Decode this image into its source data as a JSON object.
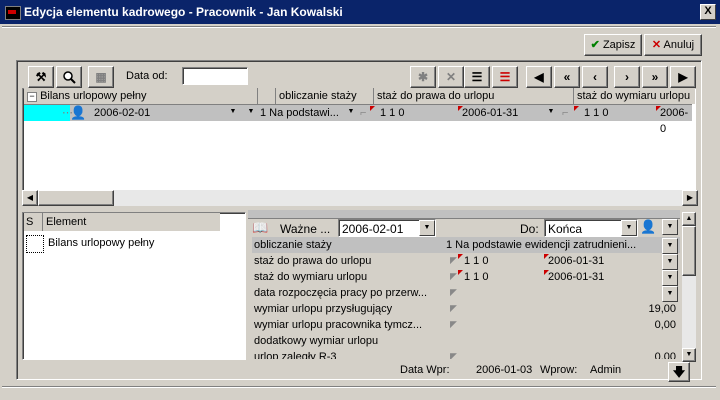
{
  "window": {
    "title": "Edycja elementu kadrowego - Pracownik - Jan Kowalski",
    "close_glyph": "X"
  },
  "actions": {
    "save": "Zapisz",
    "cancel": "Anuluj"
  },
  "toolbar": {
    "date_from_label": "Data od:",
    "date_from_value": ""
  },
  "grid": {
    "tree_header": "Bilans urlopowy pełny",
    "columns": [
      "obliczanie staży",
      "staż do prawa do urlopu",
      "staż do wymiaru urlopu"
    ],
    "row": {
      "date": "2006-02-01",
      "obliczanie": "1 Na podstawi...",
      "staz_prawa_ymd": "1  1  0",
      "staz_prawa_date": "2006-01-31",
      "staz_wymiaru_ymd": "1  1  0",
      "staz_wymiaru_date": "2006-0"
    }
  },
  "left_panel": {
    "col_s": "S",
    "col_element": "Element",
    "items": [
      "Bilans urlopowy pełny"
    ]
  },
  "detail": {
    "valid_label": "Ważne ...",
    "valid_from": "2006-02-01",
    "to_label": "Do:",
    "to_value": "Końca",
    "rows": [
      {
        "label": "obliczanie staży",
        "value": "1 Na podstawie ewidencji zatrudnieni..."
      },
      {
        "label": "staż do prawa do urlopu",
        "ymd": "1  1  0",
        "date": "2006-01-31"
      },
      {
        "label": "staż do wymiaru urlopu",
        "ymd": "1  1  0",
        "date": "2006-01-31"
      },
      {
        "label": "data rozpoczęcia pracy po przerw..."
      },
      {
        "label": "wymiar urlopu przysługujący",
        "value": "19,00"
      },
      {
        "label": "wymiar urlopu pracownika tymcz...",
        "value": "0,00"
      },
      {
        "label": "dodatkowy wymiar urlopu"
      },
      {
        "label": "urlop zaległy R-3",
        "value": "0,00"
      }
    ],
    "footer": {
      "data_wpr_label": "Data Wpr:",
      "data_wpr_value": "2006-01-03",
      "wprow_label": "Wprow:",
      "wprow_value": "Admin"
    }
  },
  "colors": {
    "title_bg": "#0a246a",
    "selection": "#00ffff",
    "dialog_bg": "#d4d0c8",
    "check_green": "#008000",
    "cancel_red": "#cc0000"
  }
}
